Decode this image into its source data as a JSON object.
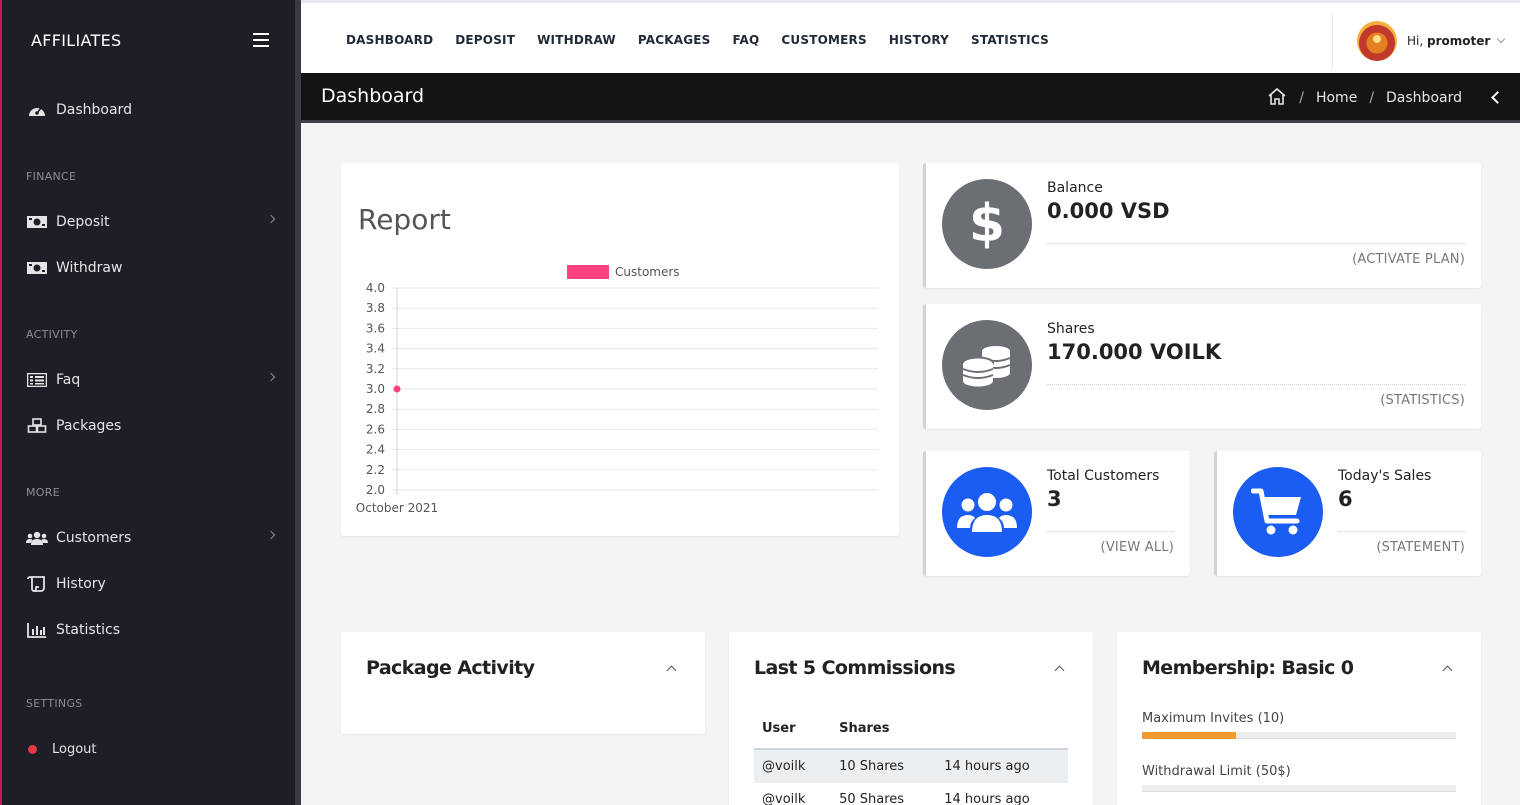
{
  "sidebar": {
    "brand": "AFFILIATES",
    "items": [
      {
        "label": "Dashboard",
        "icon": "gauge-icon"
      },
      {
        "section": "FINANCE"
      },
      {
        "label": "Deposit",
        "icon": "money-icon",
        "has_submenu": true
      },
      {
        "label": "Withdraw",
        "icon": "money-icon"
      },
      {
        "section": "ACTIVITY"
      },
      {
        "label": "Faq",
        "icon": "list-icon",
        "has_submenu": true
      },
      {
        "label": "Packages",
        "icon": "boxes-icon"
      },
      {
        "section": "MORE"
      },
      {
        "label": "Customers",
        "icon": "users-icon",
        "has_submenu": true
      },
      {
        "label": "History",
        "icon": "scroll-icon"
      },
      {
        "label": "Statistics",
        "icon": "bar-chart-icon"
      },
      {
        "section": "SETTINGS"
      },
      {
        "label": "Logout",
        "icon": "dot-icon"
      }
    ]
  },
  "topnav": [
    "DASHBOARD",
    "DEPOSIT",
    "WITHDRAW",
    "PACKAGES",
    "FAQ",
    "CUSTOMERS",
    "HISTORY",
    "STATISTICS"
  ],
  "user": {
    "greeting": "Hi,",
    "name": "promoter"
  },
  "titlebar": {
    "title": "Dashboard",
    "crumbs": [
      "Home",
      "Dashboard"
    ]
  },
  "report": {
    "title": "Report"
  },
  "chart_data": {
    "type": "line",
    "title": "",
    "x": [
      "October 2021"
    ],
    "series": [
      {
        "name": "Customers",
        "values": [
          3.0
        ],
        "color": "#ff4081"
      }
    ],
    "yticks": [
      "4.0",
      "3.8",
      "3.6",
      "3.4",
      "3.2",
      "3.0",
      "2.8",
      "2.6",
      "2.4",
      "2.2",
      "2.0"
    ],
    "ylim": [
      2.0,
      4.0
    ],
    "grid": true,
    "legend": "top-center"
  },
  "stats": {
    "balance": {
      "label": "Balance",
      "value": "0.000 VSD",
      "link": "(ACTIVATE PLAN)",
      "color": "#6b6e72"
    },
    "shares": {
      "label": "Shares",
      "value": "170.000 VOILK",
      "link": "(STATISTICS)",
      "color": "#6b6e72"
    },
    "customers": {
      "label": "Total Customers",
      "value": "3",
      "link": "(VIEW ALL)",
      "color": "#1b5cf2"
    },
    "sales": {
      "label": "Today's Sales",
      "value": "6",
      "link": "(STATEMENT)",
      "color": "#1b5cf2"
    }
  },
  "panels": {
    "package_activity": {
      "title": "Package Activity"
    },
    "commissions": {
      "title": "Last 5 Commissions",
      "headers": [
        "User",
        "Shares",
        ""
      ],
      "rows": [
        [
          "@voilk",
          "10 Shares",
          "14 hours ago"
        ],
        [
          "@voilk",
          "50 Shares",
          "14 hours ago"
        ]
      ]
    },
    "membership": {
      "title": "Membership: Basic 0",
      "meters": [
        {
          "label": "Maximum Invites (10)",
          "fill": 0.3
        },
        {
          "label": "Withdrawal Limit (50$)",
          "fill": 0
        }
      ]
    }
  }
}
